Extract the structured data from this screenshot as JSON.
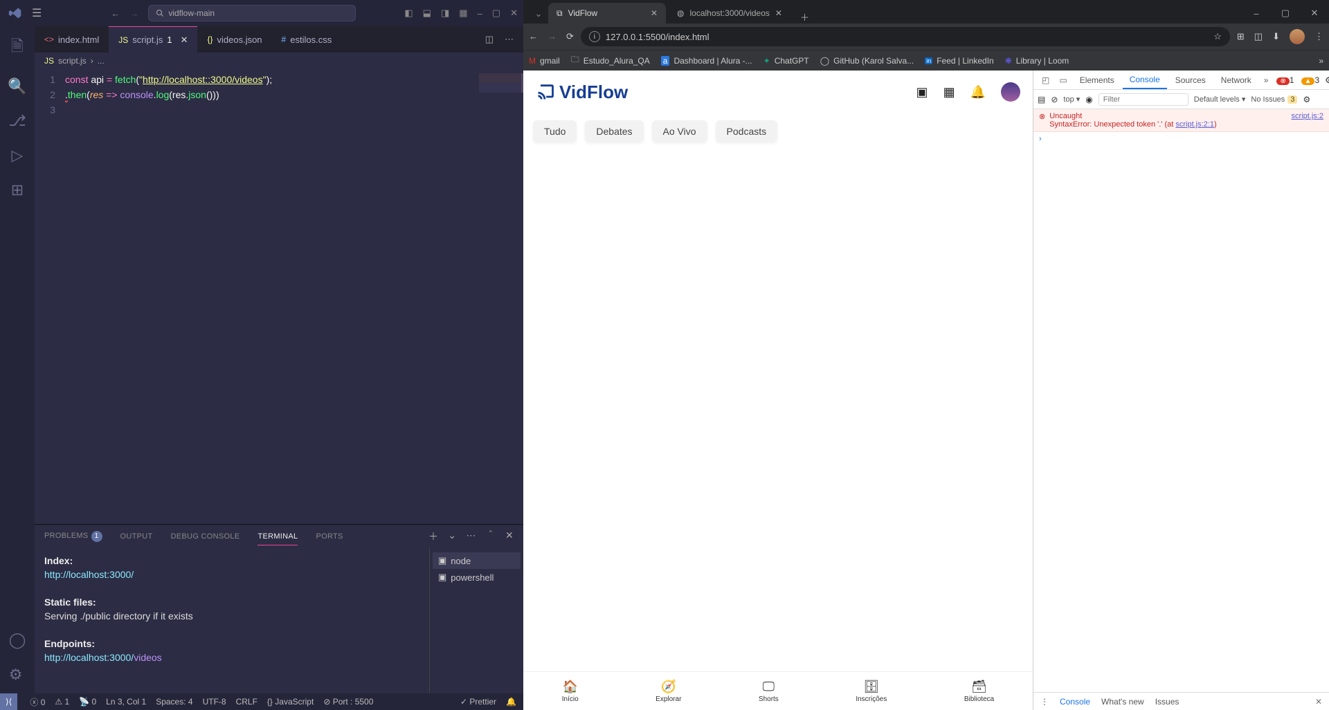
{
  "vscode": {
    "title_search": "vidflow-main",
    "tabs": [
      {
        "icon": "html",
        "label": "index.html",
        "active": false,
        "dirty": false
      },
      {
        "icon": "js",
        "label": "script.js",
        "active": true,
        "dirty": true,
        "dirty_badge": "1"
      },
      {
        "icon": "json",
        "label": "videos.json",
        "active": false,
        "dirty": false
      },
      {
        "icon": "css",
        "label": "estilos.css",
        "active": false,
        "dirty": false
      }
    ],
    "breadcrumb": {
      "file": "script.js",
      "more": "..."
    },
    "code_lines": [
      "1",
      "2",
      "3"
    ],
    "code": {
      "l1": {
        "const": "const",
        "api": "api",
        "eq": "=",
        "fetch": "fetch",
        "open": "(",
        "q1": "\"",
        "url": "http://localhost::3000/videos",
        "q2": "\"",
        "close": ");"
      },
      "l2": {
        "dot": ".",
        "then": "then",
        "open": "(",
        "res": "res",
        "arrow": "=>",
        "console": "console",
        "dot2": ".",
        "log": "log",
        "open2": "(",
        "res2": "res",
        "dot3": ".",
        "json": "json",
        "call": "()",
        "close": "))"
      }
    },
    "panel": {
      "tabs": [
        "PROBLEMS",
        "OUTPUT",
        "DEBUG CONSOLE",
        "TERMINAL",
        "PORTS"
      ],
      "problems_badge": "1",
      "active": "TERMINAL",
      "terminal": {
        "index_hdr": "Index:",
        "index_url": "http://localhost:3000/",
        "static_hdr": "Static files:",
        "static_line": "Serving ./public directory if it exists",
        "endpoints_hdr": "Endpoints:",
        "endpoints_base": "http://localhost:3000/",
        "endpoints_tail": "videos"
      },
      "term_list": [
        {
          "name": "node",
          "sel": true
        },
        {
          "name": "powershell",
          "sel": false
        }
      ]
    },
    "status": {
      "errors": "0",
      "warnings": "1",
      "warns2": "0",
      "radio": "0",
      "cursor": "Ln 3, Col 1",
      "spaces": "Spaces: 4",
      "encoding": "UTF-8",
      "eol": "CRLF",
      "lang": "JavaScript",
      "port": "Port : 5500",
      "prettier": "Prettier"
    }
  },
  "browser": {
    "tabs": [
      {
        "title": "VidFlow",
        "active": true,
        "icon": "cast"
      },
      {
        "title": "localhost:3000/videos",
        "active": false,
        "icon": "globe"
      }
    ],
    "url": "127.0.0.1:5500/index.html",
    "bookmarks": [
      {
        "icon": "M",
        "label": "gmail",
        "color": "#d93025"
      },
      {
        "icon": "📁",
        "label": "Estudo_Alura_QA",
        "color": "#ccc"
      },
      {
        "icon": "a",
        "label": "Dashboard | Alura -...",
        "color": "#2a7ae2"
      },
      {
        "icon": "◎",
        "label": "ChatGPT",
        "color": "#10a37f"
      },
      {
        "icon": "◯",
        "label": "GitHub (Karol Salva...",
        "color": "#aaa"
      },
      {
        "icon": "in",
        "label": "Feed | LinkedIn",
        "color": "#0a66c2"
      },
      {
        "icon": "❋",
        "label": "Library | Loom",
        "color": "#625df5"
      }
    ]
  },
  "vidflow": {
    "brand": "VidFlow",
    "chips": [
      "Tudo",
      "Debates",
      "Ao Vivo",
      "Podcasts"
    ],
    "bottom": [
      {
        "icon": "⌂",
        "label": "Início"
      },
      {
        "icon": "🧭",
        "label": "Explorar"
      },
      {
        "icon": "▢",
        "label": "Shorts"
      },
      {
        "icon": "☰",
        "label": "Inscrições"
      },
      {
        "icon": "▣",
        "label": "Biblioteca"
      }
    ]
  },
  "devtools": {
    "tabs": [
      "Elements",
      "Console",
      "Sources",
      "Network"
    ],
    "active": "Console",
    "err_count": "1",
    "warn_count": "3",
    "filter_placeholder": "Filter",
    "context": "top ▾",
    "levels": "Default levels ▾",
    "no_issues": "No Issues",
    "no_issues_count": "3",
    "error": {
      "line1": "Uncaught",
      "line2": "SyntaxError: Unexpected token '.' (at ",
      "link1": "script.js:2:1",
      "tail": ")",
      "src": "script.js:2"
    },
    "drawer": [
      "Console",
      "What's new",
      "Issues"
    ]
  }
}
